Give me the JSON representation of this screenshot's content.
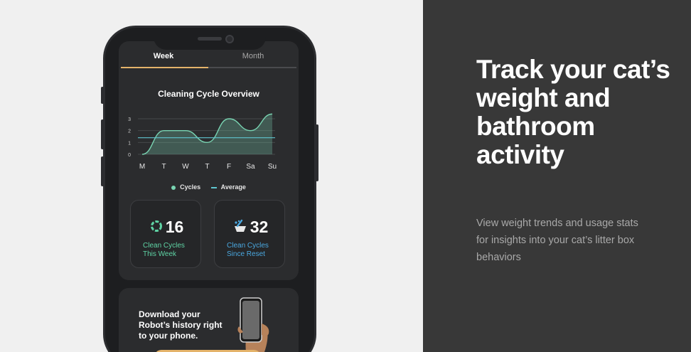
{
  "promo": {
    "headline": "Track your cat’s weight and bathroom activity",
    "subtext": "View weight trends and usage stats for insights into your cat’s litter box behaviors"
  },
  "app": {
    "tabs": [
      {
        "label": "Week",
        "active": true
      },
      {
        "label": "Month",
        "active": false
      }
    ],
    "stats": [
      {
        "value": "16",
        "label_line1": "Clean Cycles",
        "label_line2": "This Week",
        "icon": "refresh-cycle-icon",
        "color": "#5fd4a5"
      },
      {
        "value": "32",
        "label_line1": "Clean Cycles",
        "label_line2": "Since Reset",
        "icon": "litter-scoop-icon",
        "color": "#4aa8e0"
      }
    ],
    "download": {
      "text": "Download your Robot’s history right to your phone."
    }
  },
  "colors": {
    "accent_tab": "#e4b36a",
    "cycles": "#79d4b2",
    "average": "#5fc6d0",
    "background_right": "#383838"
  },
  "chart_data": {
    "type": "area",
    "title": "Cleaning Cycle Overview",
    "categories": [
      "M",
      "T",
      "W",
      "T",
      "F",
      "Sa",
      "Su"
    ],
    "y_ticks": [
      "0",
      "1",
      "2",
      "3"
    ],
    "ylim": [
      0,
      3
    ],
    "series": [
      {
        "name": "Cycles",
        "values": [
          0,
          2,
          2,
          1,
          3,
          2,
          3.4
        ]
      },
      {
        "name": "Average",
        "values": [
          1.4,
          1.4,
          1.4,
          1.4,
          1.4,
          1.4,
          1.4
        ]
      }
    ],
    "legend": "bottom",
    "grid": true
  }
}
